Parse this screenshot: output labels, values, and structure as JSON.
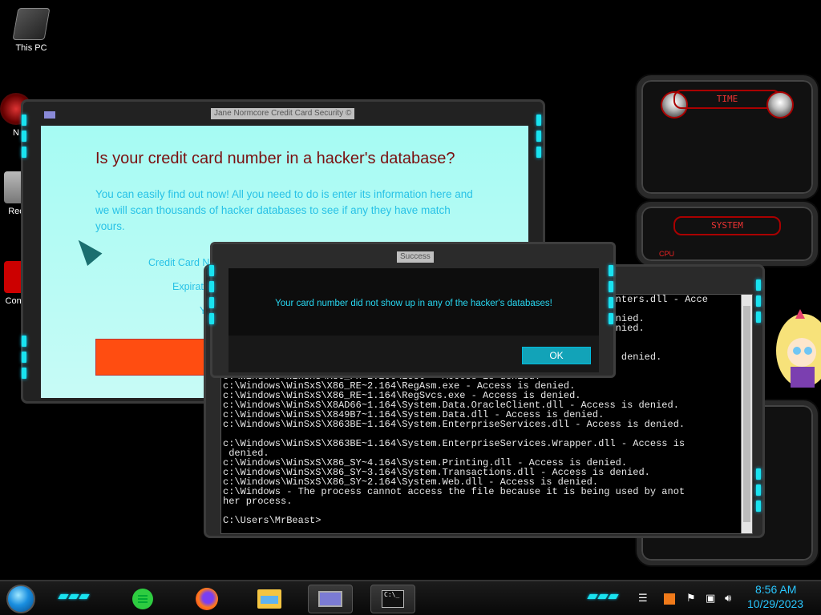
{
  "desktop": {
    "icons": [
      {
        "label": "This PC"
      },
      {
        "label": "N"
      },
      {
        "label": "Rec"
      },
      {
        "label": "Contr"
      }
    ]
  },
  "gadgets": {
    "time_label": "TIME",
    "system_label": "SYSTEM",
    "cpu_label": "CPU"
  },
  "card_window": {
    "title": "Jane Normcore Credit Card Security ©",
    "heading": "Is your credit card number in a hacker's database?",
    "blurb": "You can easily find out now! All you need to do is enter its information here and we will scan thousands of hacker databases to see if any they have match yours.",
    "fields": [
      {
        "label": "Credit Card N"
      },
      {
        "label": "Expirati"
      },
      {
        "label": "Your"
      }
    ]
  },
  "success_dialog": {
    "title": "Success",
    "message": "Your card number did not show up in any of the hacker's databases!",
    "ok_label": "OK"
  },
  "console": {
    "lines": [
      "                                                                  ounters.dll - Acce",
      "",
      "                                                                  denied.",
      "                                                                  denied.",
      "",
      "",
      "                                                                  is denied.",
      "",
      "c:\\Windows\\WinSxS\\X86_FR~2.206\\i386 - Access is denied.",
      "c:\\Windows\\WinSxS\\X86_RE~2.164\\RegAsm.exe - Access is denied.",
      "c:\\Windows\\WinSxS\\X86_RE~1.164\\RegSvcs.exe - Access is denied.",
      "c:\\Windows\\WinSxS\\X8AD66~1.164\\System.Data.OracleClient.dll - Access is denied.",
      "c:\\Windows\\WinSxS\\X849B7~1.164\\System.Data.dll - Access is denied.",
      "c:\\Windows\\WinSxS\\X863BE~1.164\\System.EnterpriseServices.dll - Access is denied.",
      "",
      "c:\\Windows\\WinSxS\\X863BE~1.164\\System.EnterpriseServices.Wrapper.dll - Access is",
      " denied.",
      "c:\\Windows\\WinSxS\\X86_SY~4.164\\System.Printing.dll - Access is denied.",
      "c:\\Windows\\WinSxS\\X86_SY~3.164\\System.Transactions.dll - Access is denied.",
      "c:\\Windows\\WinSxS\\X86_SY~2.164\\System.Web.dll - Access is denied.",
      "c:\\Windows - The process cannot access the file because it is being used by anot",
      "her process.",
      "",
      "C:\\Users\\MrBeast>"
    ]
  },
  "taskbar": {
    "apps": [
      {
        "icon": "notes-icon"
      },
      {
        "icon": "firefox-icon"
      },
      {
        "icon": "file-explorer-icon"
      },
      {
        "icon": "card-security-icon"
      },
      {
        "icon": "command-prompt-icon"
      }
    ],
    "cmd_glyph": "C:\\_",
    "clock_time": "8:56 AM",
    "clock_date": "10/29/2023"
  },
  "colors": {
    "accent_cyan": "#19e3f0",
    "heading_red": "#7a1010",
    "blurb_cyan": "#28c2e6",
    "button_orange": "#ff4d11"
  }
}
